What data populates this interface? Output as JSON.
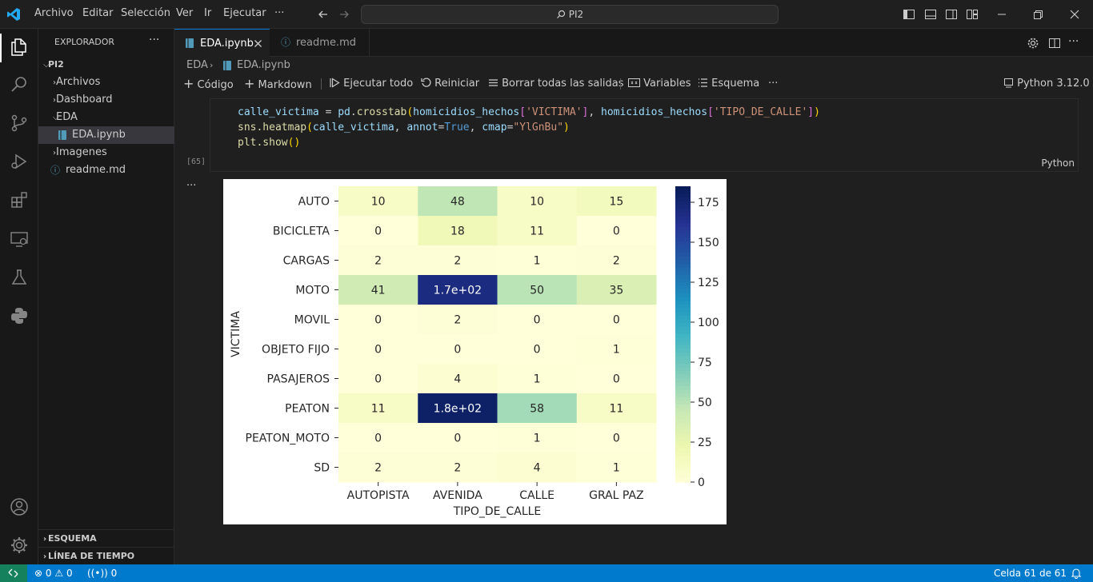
{
  "menu": [
    "Archivo",
    "Editar",
    "Selección",
    "Ver",
    "Ir",
    "Ejecutar",
    "···"
  ],
  "search": {
    "text": "PI2"
  },
  "sidebar": {
    "title": "EXPLORADOR",
    "root": "PI2",
    "items": [
      "Archivos",
      "Dashboard",
      "EDA",
      "EDA.ipynb",
      "Imagenes",
      "readme.md"
    ],
    "sections": [
      "ESQUEMA",
      "LÍNEA DE TIEMPO"
    ]
  },
  "tabs": [
    {
      "label": "EDA.ipynb",
      "active": true
    },
    {
      "label": "readme.md",
      "active": false
    }
  ],
  "breadcrumb": [
    "EDA",
    "EDA.ipynb"
  ],
  "toolbar": {
    "codigo": "Código",
    "markdown": "Markdown",
    "run_all": "Ejecutar todo",
    "restart": "Reiniciar",
    "clear": "Borrar todas las salidas",
    "variables": "Variables",
    "outline": "Esquema",
    "more": "···",
    "kernel": "Python 3.12.0"
  },
  "cell": {
    "exec_count": "[65]",
    "language": "Python",
    "l1_var": "calle_victima",
    "l1_eq": " = ",
    "l1_fn1": "pd",
    "l1_dot": ".",
    "l1_fn2": "crosstab",
    "l1_p1": "(",
    "l1_arg1": "homicidios_hechos",
    "l1_b1": "[",
    "l1_s1": "'VICTIMA'",
    "l1_b2": "]",
    "l1_comma": ", ",
    "l1_arg2": "homicidios_hechos",
    "l1_b3": "[",
    "l1_s2": "'TIPO_DE_CALLE'",
    "l1_b4": "]",
    "l1_p2": ")",
    "l2_fn": "sns.heatmap",
    "l2_p1": "(",
    "l2_a1": "calle_victima",
    "l2_c1": ", ",
    "l2_k1": "annot",
    "l2_eq1": "=",
    "l2_t": "True",
    "l2_c2": ", ",
    "l2_k2": "cmap",
    "l2_eq2": "=",
    "l2_s": "\"YlGnBu\"",
    "l2_p2": ")",
    "l3_fn": "plt.show",
    "l3_p": "()",
    "output_more": "···"
  },
  "chart_data": {
    "type": "heatmap",
    "xlabel": "TIPO_DE_CALLE",
    "ylabel": "VICTIMA",
    "x": [
      "AUTOPISTA",
      "AVENIDA",
      "CALLE",
      "GRAL PAZ"
    ],
    "y": [
      "AUTO",
      "BICICLETA",
      "CARGAS",
      "MOTO",
      "MOVIL",
      "OBJETO FIJO",
      "PASAJEROS",
      "PEATON",
      "PEATON_MOTO",
      "SD"
    ],
    "values": [
      [
        10,
        48,
        10,
        15
      ],
      [
        0,
        18,
        11,
        0
      ],
      [
        2,
        2,
        1,
        2
      ],
      [
        41,
        170,
        50,
        35
      ],
      [
        0,
        2,
        0,
        0
      ],
      [
        0,
        0,
        0,
        1
      ],
      [
        0,
        4,
        1,
        0
      ],
      [
        11,
        180,
        58,
        11
      ],
      [
        0,
        0,
        1,
        0
      ],
      [
        2,
        2,
        4,
        1
      ]
    ],
    "annotations": [
      [
        "10",
        "48",
        "10",
        "15"
      ],
      [
        "0",
        "18",
        "11",
        "0"
      ],
      [
        "2",
        "2",
        "1",
        "2"
      ],
      [
        "41",
        "1.7e+02",
        "50",
        "35"
      ],
      [
        "0",
        "2",
        "0",
        "0"
      ],
      [
        "0",
        "0",
        "0",
        "1"
      ],
      [
        "0",
        "4",
        "1",
        "0"
      ],
      [
        "11",
        "1.8e+02",
        "58",
        "11"
      ],
      [
        "0",
        "0",
        "1",
        "0"
      ],
      [
        "2",
        "2",
        "4",
        "1"
      ]
    ],
    "colorbar_ticks": [
      0,
      25,
      50,
      75,
      100,
      125,
      150,
      175
    ],
    "vmin": 0,
    "vmax": 185,
    "cmap": "YlGnBu"
  },
  "status": {
    "errors": "0",
    "warnings": "0",
    "ports": "0",
    "cell_pos": "Celda 61 de 61"
  },
  "colors": {
    "accent": "#007acc",
    "bg": "#1f1f1f"
  }
}
